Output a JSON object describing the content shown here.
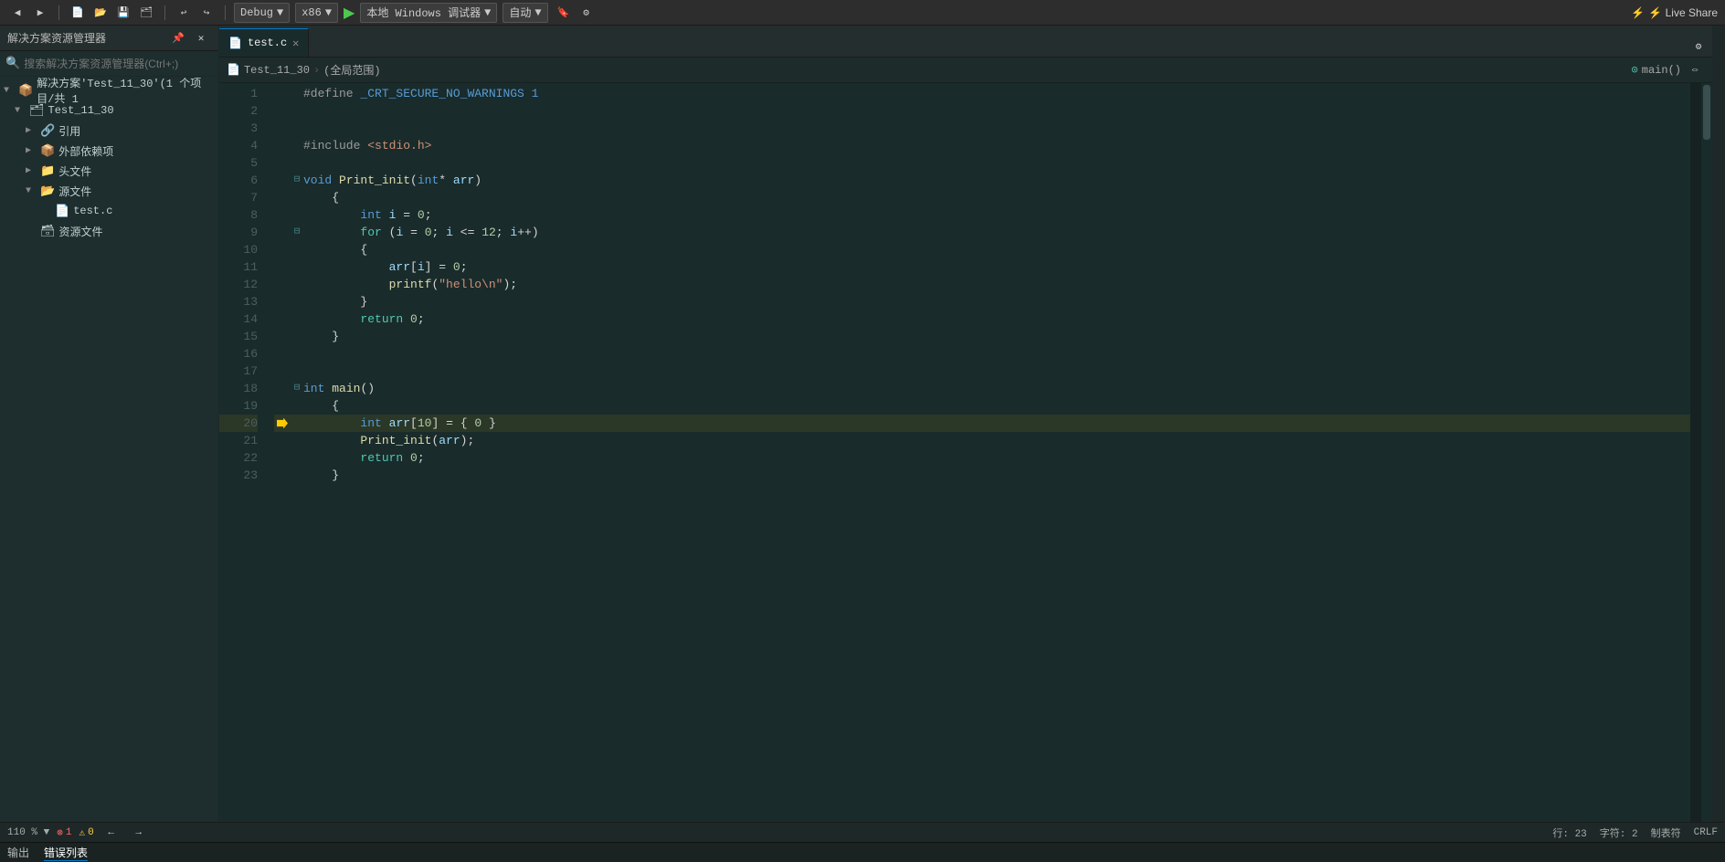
{
  "toolbar": {
    "debug_config": "Debug",
    "platform": "x86",
    "run_label": "▶",
    "debug_target": "本地 Windows 调试器",
    "auto_label": "自动",
    "live_share_label": "⚡ Live Share"
  },
  "sidebar": {
    "title": "解决方案资源管理器",
    "search_placeholder": "搜索解决方案资源管理器(Ctrl+;)",
    "solution_label": "解决方案'Test_11_30'(1 个项目/共 1",
    "project_label": "Test_11_30",
    "tree_items": [
      {
        "id": "ref",
        "label": "引用",
        "level": 1,
        "has_arrow": true,
        "arrow_open": false,
        "icon": "📁"
      },
      {
        "id": "extdeps",
        "label": "外部依赖项",
        "level": 1,
        "has_arrow": true,
        "arrow_open": false,
        "icon": "📁"
      },
      {
        "id": "headers",
        "label": "头文件",
        "level": 1,
        "has_arrow": true,
        "arrow_open": false,
        "icon": "📁"
      },
      {
        "id": "sources",
        "label": "源文件",
        "level": 1,
        "has_arrow": true,
        "arrow_open": true,
        "icon": "📂"
      },
      {
        "id": "testc",
        "label": "test.c",
        "level": 2,
        "has_arrow": false,
        "icon": "📄"
      },
      {
        "id": "resources",
        "label": "资源文件",
        "level": 1,
        "has_arrow": false,
        "icon": "📁"
      }
    ]
  },
  "editor": {
    "tab_label": "test.c",
    "nav_file": "Test_11_30",
    "nav_scope": "(全局范围)",
    "nav_func": "main()",
    "code_lines": [
      {
        "num": 1,
        "fold": false,
        "debug": false,
        "breakpoint": false,
        "text_html": "<span class='pp'>#define</span> <span class='pp-val'>_CRT_SECURE_NO_WARNINGS 1</span>"
      },
      {
        "num": 2,
        "fold": false,
        "debug": false,
        "breakpoint": false,
        "text_html": ""
      },
      {
        "num": 3,
        "fold": false,
        "debug": false,
        "breakpoint": false,
        "text_html": ""
      },
      {
        "num": 4,
        "fold": false,
        "debug": false,
        "breakpoint": false,
        "text_html": "<span class='pp'>#include</span> <span class='str'>&lt;stdio.h&gt;</span>"
      },
      {
        "num": 5,
        "fold": false,
        "debug": false,
        "breakpoint": false,
        "text_html": ""
      },
      {
        "num": 6,
        "fold": true,
        "fold_open": true,
        "debug": false,
        "breakpoint": false,
        "text_html": "<span class='kw2'>void</span> <span class='fn'>Print_init</span><span class='punc'>(</span><span class='kw2'>int</span><span class='op'>*</span> <span class='var'>arr</span><span class='punc'>)</span>"
      },
      {
        "num": 7,
        "fold": false,
        "debug": false,
        "breakpoint": false,
        "text_html": "    <span class='punc'>{</span>"
      },
      {
        "num": 8,
        "fold": false,
        "debug": false,
        "breakpoint": false,
        "text_html": "        <span class='kw2'>int</span> <span class='var'>i</span> <span class='op'>=</span> <span class='num'>0</span><span class='punc'>;</span>"
      },
      {
        "num": 9,
        "fold": true,
        "fold_open": true,
        "debug": false,
        "breakpoint": false,
        "text_html": "        <span class='kw'>for</span> <span class='punc'>(</span><span class='var'>i</span> <span class='op'>=</span> <span class='num'>0</span><span class='punc'>;</span> <span class='var'>i</span> <span class='op'>&lt;=</span> <span class='num'>12</span><span class='punc'>;</span> <span class='var'>i</span><span class='op'>++</span><span class='punc'>)</span>"
      },
      {
        "num": 10,
        "fold": false,
        "debug": false,
        "breakpoint": false,
        "text_html": "        <span class='punc'>{</span>"
      },
      {
        "num": 11,
        "fold": false,
        "debug": false,
        "breakpoint": false,
        "text_html": "            <span class='var'>arr</span><span class='punc'>[</span><span class='var'>i</span><span class='punc'>]</span> <span class='op'>=</span> <span class='num'>0</span><span class='punc'>;</span>"
      },
      {
        "num": 12,
        "fold": false,
        "debug": false,
        "breakpoint": false,
        "text_html": "            <span class='fn'>printf</span><span class='punc'>(</span><span class='str'>\"hello\\n\"</span><span class='punc'>);</span>"
      },
      {
        "num": 13,
        "fold": false,
        "debug": false,
        "breakpoint": false,
        "text_html": "        <span class='punc'>}</span>"
      },
      {
        "num": 14,
        "fold": false,
        "debug": false,
        "breakpoint": false,
        "text_html": "        <span class='kw'>return</span> <span class='num'>0</span><span class='punc'>;</span>"
      },
      {
        "num": 15,
        "fold": false,
        "debug": false,
        "breakpoint": false,
        "text_html": "    <span class='punc'>}</span>"
      },
      {
        "num": 16,
        "fold": false,
        "debug": false,
        "breakpoint": false,
        "text_html": ""
      },
      {
        "num": 17,
        "fold": false,
        "debug": false,
        "breakpoint": false,
        "text_html": ""
      },
      {
        "num": 18,
        "fold": true,
        "fold_open": true,
        "debug": false,
        "breakpoint": false,
        "text_html": "<span class='kw2'>int</span> <span class='fn'>main</span><span class='punc'>()</span>"
      },
      {
        "num": 19,
        "fold": false,
        "debug": false,
        "breakpoint": false,
        "text_html": "    <span class='punc'>{</span>"
      },
      {
        "num": 20,
        "fold": false,
        "debug": true,
        "breakpoint": false,
        "highlighted": true,
        "text_html": "        <span class='kw2'>int</span> <span class='var'>arr</span><span class='punc'>[</span><span class='num'>10</span><span class='punc'>]</span> <span class='op'>=</span> <span class='punc'>{</span> <span class='num'>0</span> <span class='punc'>}</span>"
      },
      {
        "num": 21,
        "fold": false,
        "debug": false,
        "breakpoint": false,
        "text_html": "        <span class='fn'>Print_init</span><span class='punc'>(</span><span class='var'>arr</span><span class='punc'>);</span>"
      },
      {
        "num": 22,
        "fold": false,
        "debug": false,
        "breakpoint": false,
        "text_html": "        <span class='kw'>return</span> <span class='num'>0</span><span class='punc'>;</span>"
      },
      {
        "num": 23,
        "fold": false,
        "debug": false,
        "breakpoint": false,
        "text_html": "    <span class='punc'>}</span>"
      }
    ]
  },
  "statusbar": {
    "errors": "1",
    "warnings": "0",
    "zoom": "110 %",
    "row": "行: 23",
    "col": "字符: 2",
    "charset": "制表符",
    "lineending": "CRLF",
    "nav_back": "←",
    "nav_fwd": "→"
  },
  "tabs": {
    "output": "输出",
    "error_list": "错误列表"
  }
}
